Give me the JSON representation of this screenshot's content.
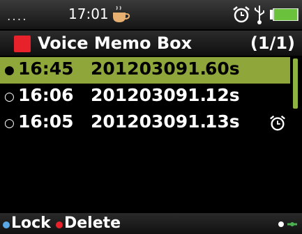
{
  "statusbar": {
    "signal": "....",
    "time": "17:01",
    "icons": [
      "coffee-cup-icon",
      "alarm-clock-icon",
      "usb-icon",
      "battery-icon"
    ]
  },
  "title": {
    "label": "Voice Memo Box",
    "page": "(1/1)",
    "icon": "red-square-icon",
    "icon_color": "#e8222b"
  },
  "memos": [
    {
      "time": "16:45",
      "name": "201203091..",
      "duration": "60s",
      "selected": true,
      "alarm": false
    },
    {
      "time": "16:06",
      "name": "201203091..",
      "duration": "12s",
      "selected": false,
      "alarm": false
    },
    {
      "time": "16:05",
      "name": "201203091..",
      "duration": "13s",
      "selected": false,
      "alarm": true
    }
  ],
  "softkeys": {
    "left": "Lock",
    "left_color": "#5aa9e6",
    "center": "Delete",
    "center_color": "#e8222b",
    "nav_icon": "dpad-icon"
  },
  "colors": {
    "selection": "#8fa63a",
    "scroll_thumb": "#8fb340"
  }
}
